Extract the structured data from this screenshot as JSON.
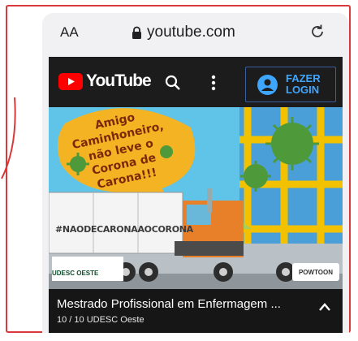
{
  "browser": {
    "text_size_label": "AA",
    "url": "youtube.com"
  },
  "youtube": {
    "logo_text": "YouTube",
    "login_line1": "FAZER",
    "login_line2": "LOGIN"
  },
  "thumbnail": {
    "speech_bubble": "Amigo Caminhoneiro, não leve o Corona de Carona!!!",
    "hashtag": "#NAODECARONAAOCORONA",
    "sponsor_logo": "UDESC OESTE",
    "watermark": "POWTOON"
  },
  "video": {
    "title": "Mestrado Profissional em Enfermagem ...",
    "meta": "10 / 10  UDESC Oeste"
  },
  "colors": {
    "annotation_red": "#d9393b",
    "youtube_red": "#ff0000",
    "login_blue": "#3ea6ff"
  },
  "icons": [
    "lock-icon",
    "reload-icon",
    "youtube-play-icon",
    "search-icon",
    "more-vert-icon",
    "account-icon",
    "chevron-up-icon"
  ]
}
